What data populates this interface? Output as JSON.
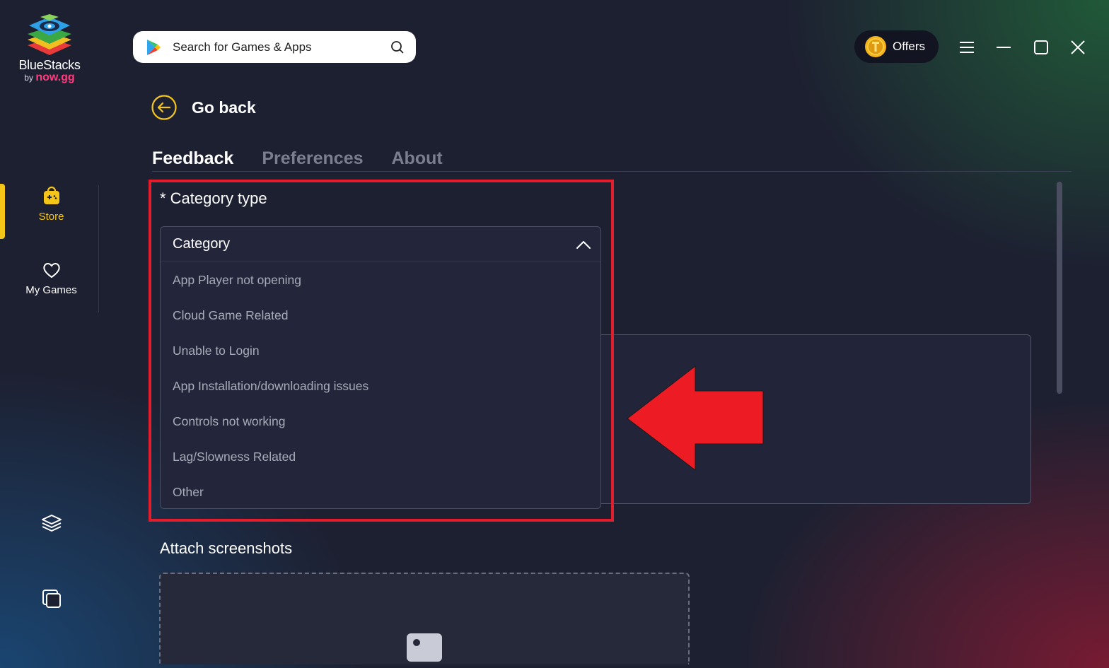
{
  "app": {
    "logo_name": "BlueStacks",
    "logo_by": "by",
    "logo_brand": "now.gg"
  },
  "sidebar": {
    "items": [
      {
        "label": "Store",
        "icon": "store-bag-icon",
        "active": true
      },
      {
        "label": "My Games",
        "icon": "heart-icon",
        "active": false
      }
    ],
    "bottom_icons": [
      "layers-icon",
      "multi-instance-icon"
    ]
  },
  "search": {
    "placeholder": "Search for Games & Apps"
  },
  "topbar": {
    "offers_label": "Offers",
    "window_controls": [
      "menu-icon",
      "minimize-icon",
      "maximize-icon",
      "close-icon"
    ]
  },
  "page": {
    "go_back_label": "Go back",
    "tabs": [
      {
        "label": "Feedback",
        "active": true
      },
      {
        "label": "Preferences",
        "active": false
      },
      {
        "label": "About",
        "active": false
      }
    ]
  },
  "category": {
    "title": "* Category type",
    "selected": "Category",
    "options": [
      "App Player not opening",
      "Cloud Game Related",
      "Unable to Login",
      "App Installation/downloading issues",
      "Controls not working",
      "Lag/Slowness Related",
      "Other"
    ]
  },
  "attach": {
    "title": "Attach screenshots"
  },
  "colors": {
    "accent": "#f5c518",
    "highlight": "#e31d2b",
    "background": "#1d2031"
  }
}
